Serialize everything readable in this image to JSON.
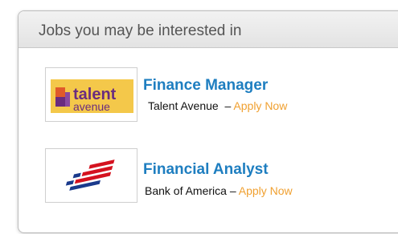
{
  "panel": {
    "title": "Jobs you may be interested in"
  },
  "jobs": [
    {
      "title": "Finance Manager",
      "company": "Talent Avenue",
      "separator": "  – ",
      "apply_label": "Apply Now",
      "logo": {
        "icon": "talent-avenue-logo",
        "line1": "talent",
        "line2": "avenue",
        "colors": {
          "primary": "#6a2c7f",
          "accent": "#f0a530",
          "background": "#f4c84a"
        }
      }
    },
    {
      "title": "Financial Analyst",
      "company": "Bank of America",
      "separator": " – ",
      "apply_label": "Apply Now",
      "logo": {
        "icon": "bank-of-america-flag-logo",
        "colors": {
          "red": "#d4121f",
          "blue": "#1a3a8c"
        }
      }
    }
  ],
  "colors": {
    "title_link": "#1e7ec0",
    "apply_link": "#f0a030",
    "header_text": "#555555"
  }
}
